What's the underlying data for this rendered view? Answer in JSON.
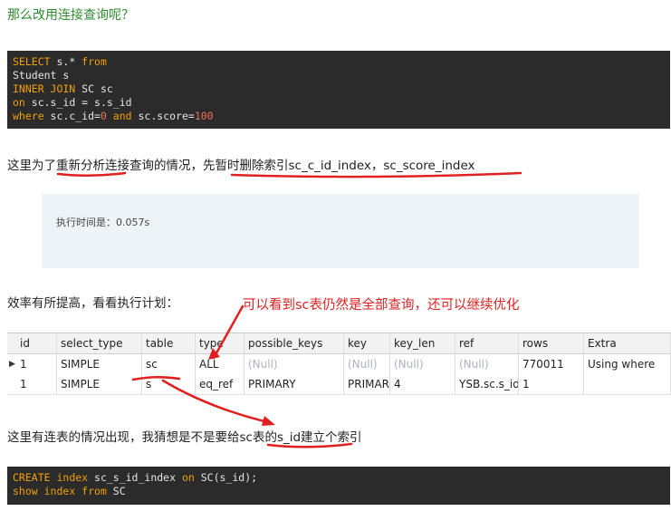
{
  "heading": "那么改用连接查询呢？",
  "code1": {
    "l1": {
      "kw": "SELECT",
      "rest": " s.* ",
      "kw2": "from"
    },
    "l2": "Student s",
    "l3": {
      "kw": "INNER JOIN",
      "rest": " SC sc"
    },
    "l4": {
      "kw": "on",
      "rest": " sc.s_id = s.s_id"
    },
    "l5": {
      "kw": "where",
      "a": " sc.c_id=",
      "n1": "0",
      "kw2": " and",
      "b": " sc.score=",
      "n2": "100"
    }
  },
  "para1": "这里为了重新分析连接查询的情况，先暂时删除索引sc_c_id_index，sc_score_index",
  "note": "执行时间是：0.057s",
  "para2": "效率有所提高，看看执行计划：",
  "red_note": "可以看到sc表仍然是全部查询，还可以继续优化",
  "grid": {
    "headers": [
      "id",
      "select_type",
      "table",
      "type",
      "possible_keys",
      "key",
      "key_len",
      "ref",
      "rows",
      "Extra"
    ],
    "rows": [
      [
        "1",
        "SIMPLE",
        "sc",
        "ALL",
        "(Null)",
        "(Null)",
        "(Null)",
        "(Null)",
        "770011",
        "Using where"
      ],
      [
        "1",
        "SIMPLE",
        "s",
        "eq_ref",
        "PRIMARY",
        "PRIMAR",
        "4",
        "YSB.sc.s_id",
        "1",
        ""
      ]
    ],
    "current_row_marker": "▶"
  },
  "para3": "这里有连表的情况出现，我猜想是不是要给sc表的s_id建立个索引",
  "code2": {
    "l1": {
      "kw": "CREATE",
      "kw_b": " index",
      "a": " sc_s_id_index ",
      "kw2": "on",
      "b": " SC(s_id);"
    },
    "l2": {
      "kw": "show",
      "kw_b": " index",
      "kw2": " from",
      "b": " SC"
    }
  }
}
